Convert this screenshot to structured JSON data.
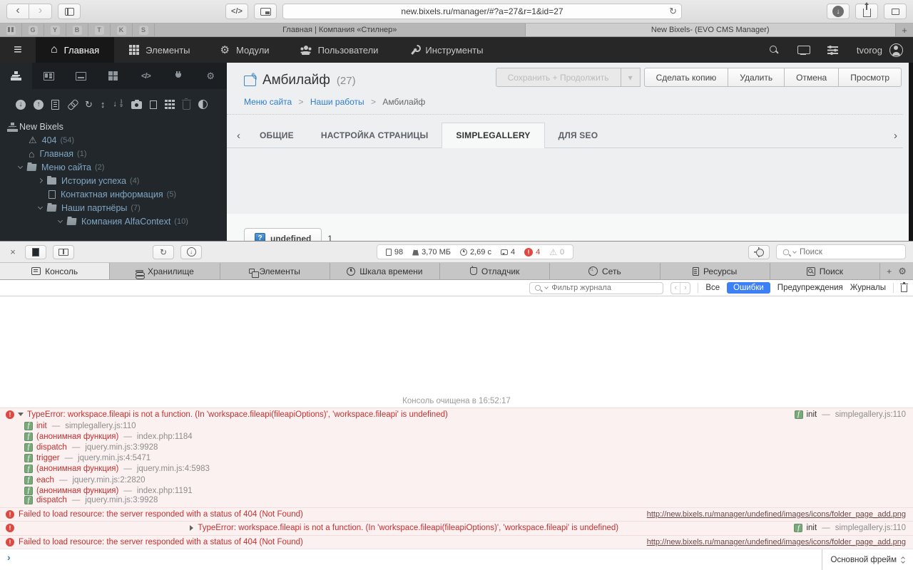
{
  "browser": {
    "back": "‹",
    "forward": "›",
    "code_button": "</>",
    "url": "new.bixels.ru/manager/#?a=27&r=1&id=27",
    "reload": "↻",
    "download_arrow": "↓",
    "pinned": [
      "",
      "G",
      "Y",
      "B",
      "T",
      "K",
      "S"
    ],
    "tab_inactive": "Главная | Компания «Стилнер»",
    "tab_active": "New Bixels- (EVO CMS Manager)",
    "new_tab": "+"
  },
  "nav": {
    "burger": "≡",
    "home_glyph": "⌂",
    "gear_glyph": "⚙",
    "items": [
      "Главная",
      "Элементы",
      "Модули",
      "Пользователи",
      "Инструменты"
    ],
    "user": "tvorog"
  },
  "sidebar": {
    "site_name": "New Bixels",
    "warn_glyph": "⚠",
    "home_glyph": "⌂",
    "refresh_glyph": "↻",
    "updown_glyph": "↕",
    "tree": [
      {
        "label": "404",
        "count": "(54)"
      },
      {
        "label": "Главная",
        "count": "(1)"
      },
      {
        "label": "Меню сайта",
        "count": "(2)"
      },
      {
        "label": "Истории успеха",
        "count": "(4)"
      },
      {
        "label": "Контактная информация",
        "count": "(5)"
      },
      {
        "label": "Наши партнёры",
        "count": "(7)"
      },
      {
        "label": "Компания AlfaContext",
        "count": "(10)"
      }
    ]
  },
  "page": {
    "title": "Амбилайф",
    "title_count": "(27)",
    "breadcrumb": [
      "Меню сайта",
      "Наши работы",
      "Амбилайф"
    ],
    "breadcrumb_sep": ">",
    "buttons": {
      "save": "Сохранить + Продолжить",
      "save_dd": "▾",
      "copy": "Сделать копию",
      "delete": "Удалить",
      "cancel": "Отмена",
      "view": "Просмотр"
    },
    "tab_scroll_left": "‹",
    "tab_scroll_right": "›",
    "tabs": [
      "ОБЩИЕ",
      "НАСТРОЙКА СТРАНИЦЫ",
      "SIMPLEGALLERY",
      "ДЛЯ SEO"
    ],
    "active_tab": "SIMPLEGALLERY",
    "content": {
      "help_glyph": "?",
      "undefined_button": "undefined",
      "value": "1"
    }
  },
  "inspector": {
    "close": "×",
    "reload": "↻",
    "download_arrow": "↓",
    "stats": {
      "resources": "98",
      "size": "3,70 МБ",
      "time": "2,69 с",
      "messages": "4",
      "errors": "4",
      "warnings": "0",
      "error_glyph": "!",
      "warn_glyph": "⚠"
    },
    "search_placeholder": "Поиск",
    "tabs": [
      "Консоль",
      "Хранилище",
      "Элементы",
      "Шкала времени",
      "Отладчик",
      "Сеть",
      "Ресурсы",
      "Поиск"
    ],
    "active_tab": "Консоль",
    "add_tab": "+",
    "gear": "⚙",
    "filter": {
      "placeholder": "Фильтр журнала",
      "prev": "‹",
      "next": "›",
      "scopes": [
        "Все",
        "Ошибки",
        "Предупреждения",
        "Журналы"
      ],
      "active_scope": "Ошибки"
    },
    "console": {
      "cleared": "Консоль очищена в 16:52:17",
      "sep": "—",
      "error_glyph": "!",
      "type_error": "TypeError: workspace.fileapi is not a function. (In 'workspace.fileapi(fileapiOptions)', 'workspace.fileapi' is undefined)",
      "origin_fn": "init",
      "origin_loc": "simplegallery.js:110",
      "frames": [
        {
          "fn": "init",
          "loc": "simplegallery.js:110"
        },
        {
          "fn": "(анонимная функция)",
          "loc": "index.php:1184"
        },
        {
          "fn": "dispatch",
          "loc": "jquery.min.js:3:9928"
        },
        {
          "fn": "trigger",
          "loc": "jquery.min.js:4:5471"
        },
        {
          "fn": "(анонимная функция)",
          "loc": "jquery.min.js:4:5983"
        },
        {
          "fn": "each",
          "loc": "jquery.min.js:2:2820"
        },
        {
          "fn": "(анонимная функция)",
          "loc": "index.php:1191"
        },
        {
          "fn": "dispatch",
          "loc": "jquery.min.js:3:9928"
        }
      ],
      "failed": "Failed to load resource: the server responded with a status of 404 (Not Found)",
      "failed_url": "http://new.bixels.ru/manager/undefined/images/icons/folder_page_add.png",
      "prompt": "›"
    },
    "frame_selector": "Основной фрейм"
  }
}
